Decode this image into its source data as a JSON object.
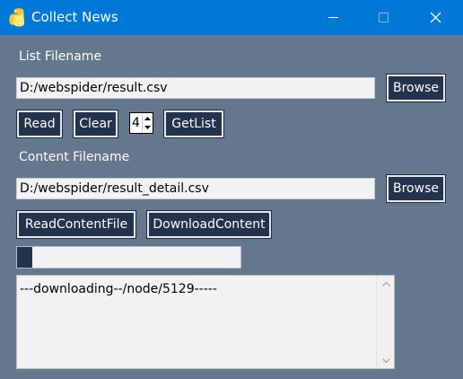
{
  "window": {
    "title": "Collect News",
    "app_icon": "python-icon",
    "controls": [
      "minimize-icon",
      "maximize-icon",
      "close-icon"
    ]
  },
  "list_section": {
    "label": "List Filename",
    "filename": "D:/webspider/result.csv",
    "browse_label": "Browse",
    "read_label": "Read",
    "clear_label": "Clear",
    "spin_value": "4",
    "getlist_label": "GetList"
  },
  "content_section": {
    "label": "Content Filename",
    "filename": "D:/webspider/result_detail.csv",
    "browse_label": "Browse",
    "read_content_label": "ReadContentFile",
    "download_content_label": "DownloadContent"
  },
  "progress": {
    "value_fraction": 0.07
  },
  "log": {
    "text": "---downloading--/node/5129-----"
  },
  "colors": {
    "titlebar": "#0078d7",
    "window_bg": "#64778d",
    "button_bg": "#23324d",
    "field_bg": "#f2f2f5"
  }
}
